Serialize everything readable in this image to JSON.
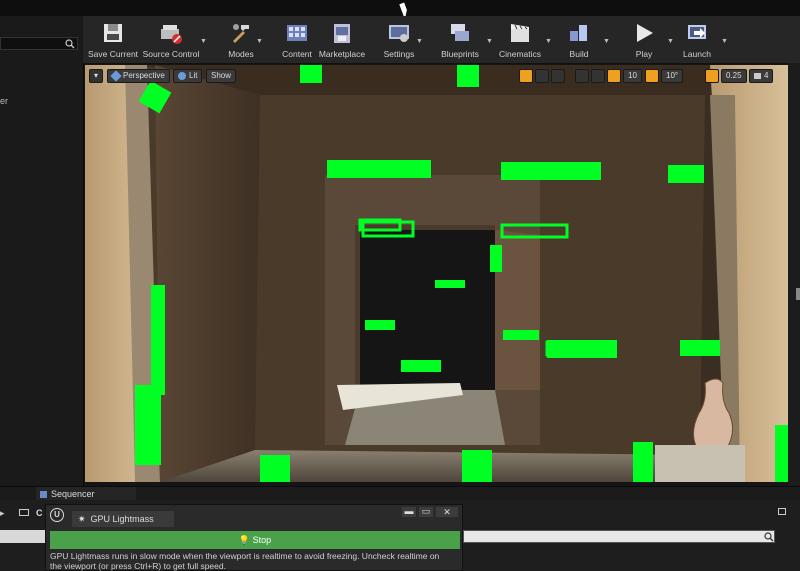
{
  "toolbar": {
    "buttons": [
      {
        "label": "Save Current",
        "icon": "save-icon"
      },
      {
        "label": "Source Control",
        "icon": "source-control-icon"
      },
      {
        "label": "Modes",
        "icon": "modes-icon"
      },
      {
        "label": "Content",
        "icon": "content-icon"
      },
      {
        "label": "Marketplace",
        "icon": "marketplace-icon"
      },
      {
        "label": "Settings",
        "icon": "settings-icon"
      },
      {
        "label": "Blueprints",
        "icon": "blueprints-icon"
      },
      {
        "label": "Cinematics",
        "icon": "cinematics-icon"
      },
      {
        "label": "Build",
        "icon": "build-icon"
      },
      {
        "label": "Play",
        "icon": "play-icon"
      },
      {
        "label": "Launch",
        "icon": "launch-icon"
      }
    ]
  },
  "left_panel": {
    "partial_text": "er"
  },
  "viewport": {
    "view_mode": "Perspective",
    "lighting": "Lit",
    "show": "Show",
    "grid_snap": "10",
    "rotation_snap": "10°",
    "scale_snap": "0.25",
    "camera_speed": "4"
  },
  "bottom": {
    "sequencer_tab": "Sequencer",
    "partial_tab": "C"
  },
  "gpu_lightmass": {
    "title": "GPU Lightmass",
    "stop_label": "Stop",
    "message": "GPU Lightmass runs in slow mode when the viewport is realtime to avoid freezing. Uncheck realtime on the viewport (or press Ctrl+R) to get full speed."
  },
  "colors": {
    "accent_green": "#00ff22",
    "stop_button": "#4aa14a",
    "toolbar_bg": "#262626",
    "highlight": "#f0a020"
  }
}
